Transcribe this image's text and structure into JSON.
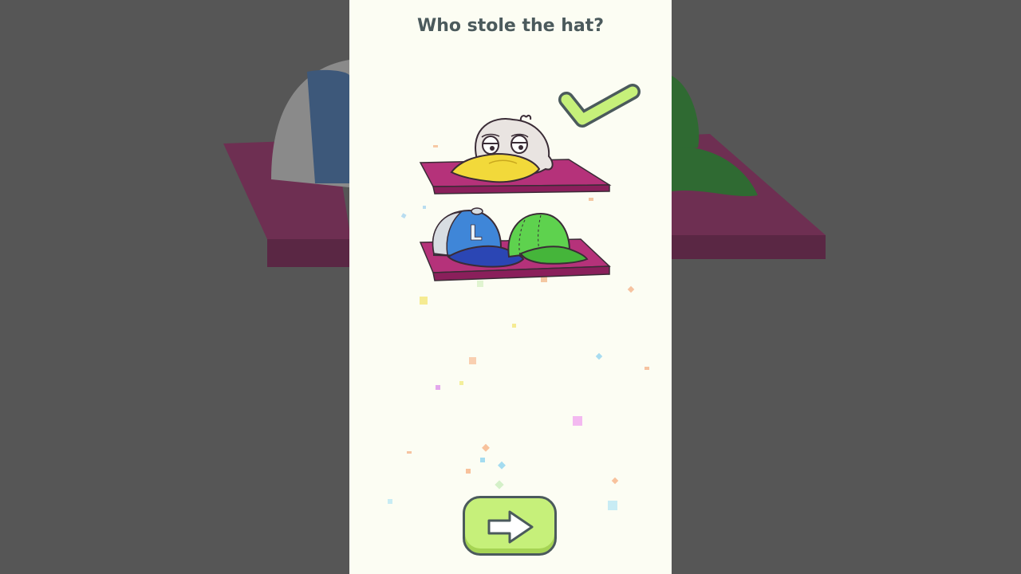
{
  "level": {
    "question": "Who stole the hat?",
    "answer_marked_correct": true
  },
  "cap_letter": "L",
  "icons": {
    "check": "checkmark-icon",
    "next": "arrow-right-icon"
  },
  "colors": {
    "page_bg": "#fcfdf3",
    "outer_bg": "#555555",
    "shelf": "#b5327a",
    "check_fill": "#c6f07a",
    "button_fill": "#c6f07a",
    "outline": "#4b5a5c",
    "blue_cap": "#3f86d8",
    "green_cap": "#5ed24e",
    "duck_bill": "#f2d93a"
  }
}
